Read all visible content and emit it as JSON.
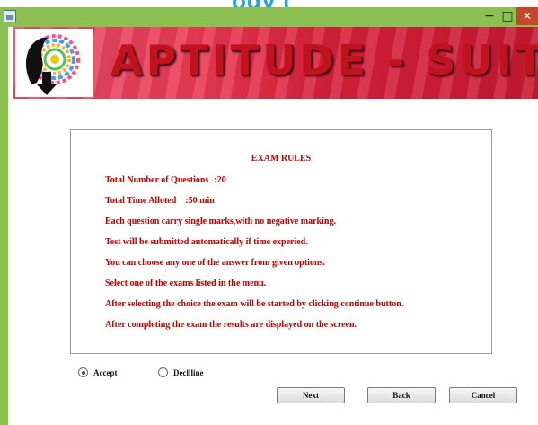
{
  "header_fragment": "ogy (",
  "window": {
    "minimize": "−",
    "maximize": "□",
    "close": "✕"
  },
  "banner": {
    "title": "APTITUDE - SUITE",
    "logo_icon": "head-color-wheel-icon"
  },
  "rules": {
    "heading": "EXAM RULES",
    "total_questions": {
      "label": "Total Number of Questions",
      "value": ":20"
    },
    "total_time": {
      "label": "Total Time Alloted",
      "value": ":50 min"
    },
    "items": [
      "Each question carry single marks,with no negative marking.",
      "Test will be submitted automatically if time experied.",
      "You can choose any one of the answer from given options.",
      "Select one of the exams listed in the menu.",
      "After selecting the choice the exam will be started by clicking continue button.",
      "After completing the exam the results are displayed on the screen."
    ]
  },
  "consent": {
    "accept": "Accept",
    "decline": "Decllline",
    "selected": "accept"
  },
  "buttons": {
    "next": "Next",
    "back": "Back",
    "cancel": "Cancel"
  },
  "colors": {
    "titlebar": "#8cc152",
    "rules_text": "#c00000",
    "banner_title": "#c1121f"
  }
}
